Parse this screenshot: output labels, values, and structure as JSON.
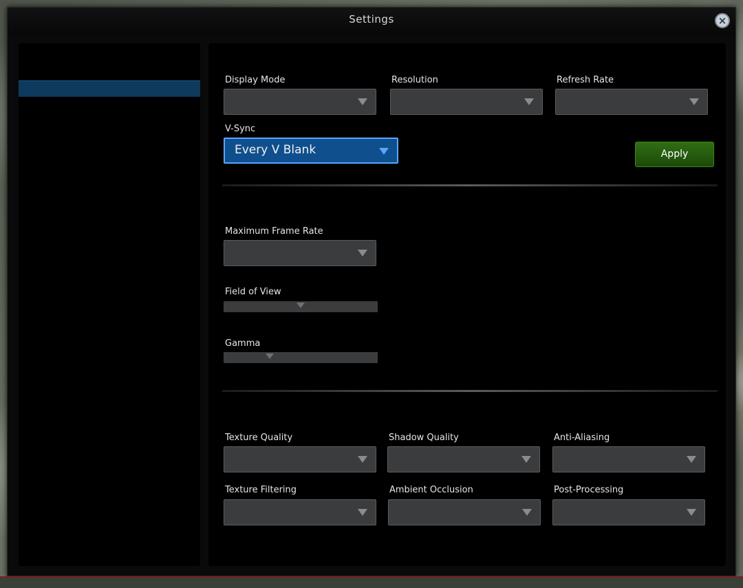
{
  "window": {
    "title": "Settings",
    "close_icon": "close-icon"
  },
  "sidebar": {
    "items": [
      {
        "label": "",
        "selected": true
      }
    ]
  },
  "display_section": {
    "row1": [
      {
        "label": "Display Mode",
        "value": ""
      },
      {
        "label": "Resolution",
        "value": ""
      },
      {
        "label": "Refresh Rate",
        "value": ""
      }
    ],
    "vsync": {
      "label": "V-Sync",
      "value": "Every V Blank"
    },
    "apply_label": "Apply"
  },
  "middle_section": {
    "dropdown": {
      "label": "Maximum Frame Rate",
      "value": ""
    },
    "slider1": {
      "label": "Field of View",
      "value": 0.5
    },
    "slider2": {
      "label": "Gamma",
      "value": 0.3
    }
  },
  "quality_section": {
    "row1": [
      {
        "label": "Texture Quality",
        "value": ""
      },
      {
        "label": "Shadow Quality",
        "value": ""
      },
      {
        "label": "Anti-Aliasing",
        "value": ""
      }
    ],
    "row2": [
      {
        "label": "Texture Filtering",
        "value": ""
      },
      {
        "label": "Ambient Occlusion",
        "value": ""
      },
      {
        "label": "Post-Processing",
        "value": ""
      }
    ]
  },
  "colors": {
    "accent": "#0f4f8e",
    "apply": "#2f6e14"
  }
}
